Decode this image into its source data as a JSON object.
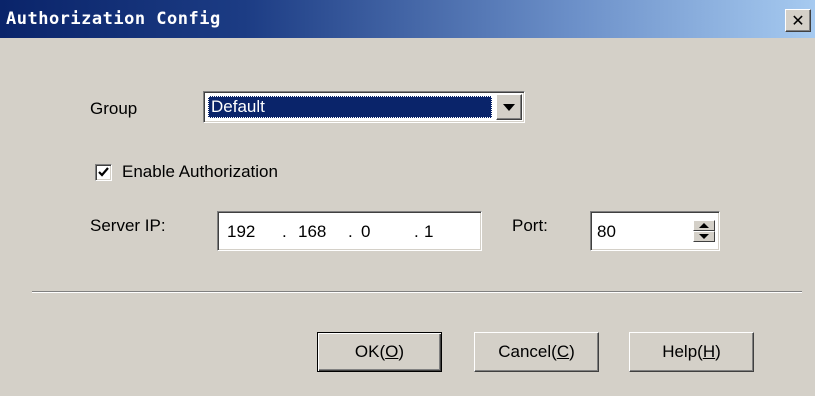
{
  "window": {
    "title": "Authorization Config",
    "close_glyph": "✕"
  },
  "form": {
    "group_label": "Group",
    "group_value": "Default",
    "enable_label": "Enable Authorization",
    "enable_checked": true,
    "server_ip_label": "Server IP:",
    "ip_octets": [
      "192",
      "168",
      "0",
      "1"
    ],
    "ip_dot": ".",
    "port_label": "Port:",
    "port_value": "80"
  },
  "buttons": {
    "ok_text": "OK(",
    "ok_key": "O",
    "ok_close": ")",
    "cancel_text": "Cancel(",
    "cancel_key": "C",
    "cancel_close": ")",
    "help_text": "Help(",
    "help_key": "H",
    "help_close": ")"
  },
  "colors": {
    "face": "#d4d0c8",
    "title_start": "#0a246a",
    "title_end": "#a6caf0",
    "selection": "#0a246a"
  }
}
